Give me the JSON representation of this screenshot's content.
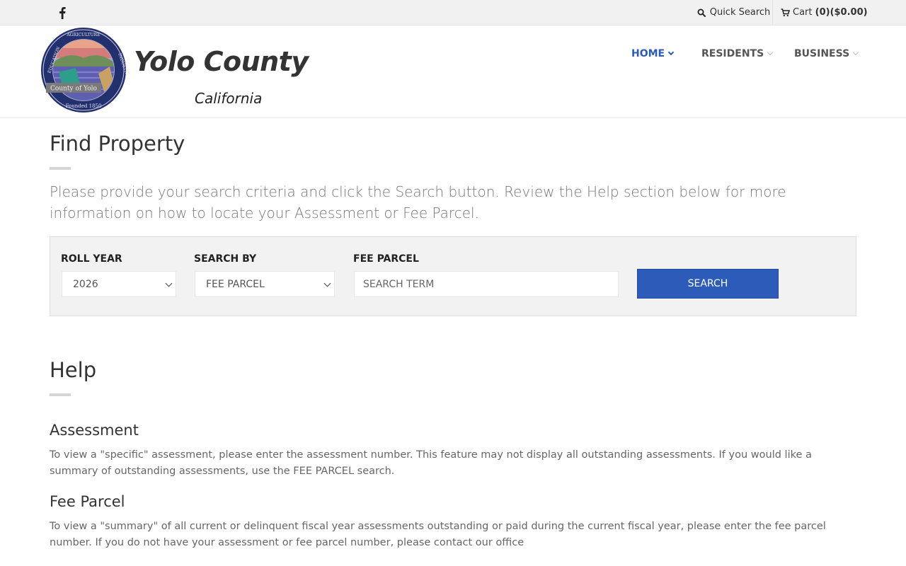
{
  "topbar": {
    "quick_search_label": "Quick Search",
    "cart_label": "Cart",
    "cart_value": "(0)($0.00)"
  },
  "brand": {
    "title": "Yolo County",
    "subtitle": "California",
    "seal": {
      "name": "County of Yolo",
      "founded": "Founded 1850",
      "words": [
        "EDUCATION",
        "AGRICULTURE",
        "INDUSTRY"
      ]
    }
  },
  "nav": {
    "items": [
      {
        "label": "HOME",
        "active": true
      },
      {
        "label": "RESIDENTS",
        "active": false
      },
      {
        "label": "BUSINESS",
        "active": false
      }
    ]
  },
  "find_property": {
    "title": "Find Property",
    "lead": "Please provide your search criteria and click the Search button. Review the Help section below for more information on how to locate your Assessment or Fee Parcel."
  },
  "search_form": {
    "roll_year_label": "ROLL YEAR",
    "roll_year_value": "2026",
    "search_by_label": "SEARCH BY",
    "search_by_value": "FEE PARCEL",
    "term_label": "FEE PARCEL",
    "term_placeholder": "SEARCH TERM",
    "search_button": "SEARCH"
  },
  "help": {
    "title": "Help",
    "sections": [
      {
        "heading": "Assessment",
        "text": "To view a \"specific\" assessment, please enter the assessment number. This feature may not display all outstanding assessments. If you would like a summary of outstanding assessments, use the FEE PARCEL search."
      },
      {
        "heading": "Fee Parcel",
        "text": "To view a \"summary\" of all current or delinquent fiscal year assessments outstanding or paid during the current fiscal year, please enter the fee parcel number. If you do not have your assessment or fee parcel number, please contact our office"
      }
    ]
  },
  "colors": {
    "accent": "#2c5bb9",
    "topbar_bg": "#f1f1f1",
    "panel_bg": "#f2f2f2"
  },
  "icons": [
    "facebook-icon",
    "search-icon",
    "cart-icon",
    "chevron-down-icon"
  ]
}
